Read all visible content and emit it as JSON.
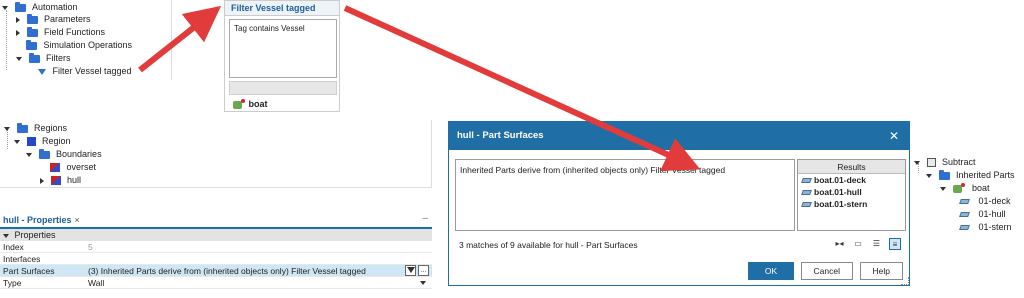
{
  "automation_tree": {
    "root": "Automation",
    "items": [
      "Parameters",
      "Field Functions",
      "Simulation Operations",
      "Filters"
    ],
    "filter_child": "Filter Vessel tagged"
  },
  "filter_popup": {
    "title": "Filter Vessel tagged",
    "criteria": "Tag contains Vessel",
    "result": "boat"
  },
  "regions_tree": {
    "root": "Regions",
    "region": "Region",
    "boundaries": "Boundaries",
    "children": [
      "overset",
      "hull"
    ]
  },
  "properties": {
    "tab": "hull - Properties",
    "section": "Properties",
    "rows": [
      {
        "key": "Index",
        "value": "5"
      },
      {
        "key": "Interfaces",
        "value": ""
      },
      {
        "key": "Part Surfaces",
        "value": "(3) Inherited Parts derive from (inherited objects only) Filter Vessel tagged"
      },
      {
        "key": "Type",
        "value": "Wall"
      }
    ]
  },
  "dialog": {
    "title": "hull - Part Surfaces",
    "description": "Inherited Parts derive from (inherited objects only) Filter Vessel tagged",
    "results_header": "Results",
    "results": [
      "boat.01-deck",
      "boat.01-hull",
      "boat.01-stern"
    ],
    "count": "3 matches of 9 available for hull - Part Surfaces",
    "ok": "OK",
    "cancel": "Cancel",
    "help": "Help"
  },
  "subtract_tree": {
    "root": "Subtract",
    "inherited": "Inherited Parts",
    "boat": "boat",
    "children": [
      "01-deck",
      "01-hull",
      "01-stern"
    ]
  },
  "colors": {
    "accent": "#1f6fa6",
    "arrow": "#e23b3b",
    "folder": "#2f6fd1",
    "selection": "#cfe6f4"
  }
}
